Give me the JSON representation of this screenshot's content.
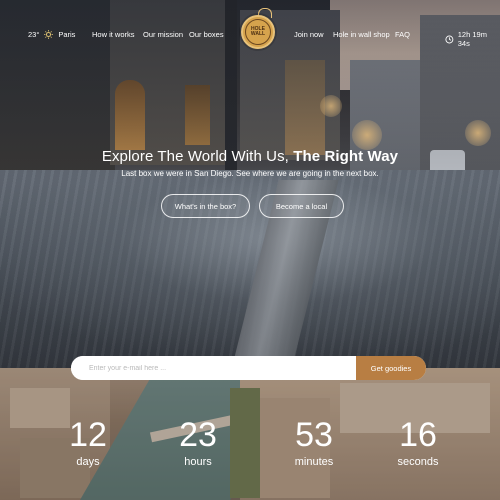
{
  "nav": {
    "temperature": "23°",
    "city": "Paris",
    "links": [
      "How it works",
      "Our mission",
      "Our boxes"
    ],
    "right_links": [
      "Join now",
      "Hole in wall shop",
      "FAQ"
    ],
    "timer": "12h 19m 34s",
    "icons": {
      "weather": "sun-icon",
      "timer": "clock-icon"
    },
    "logo": "HOLE IN THE WALL"
  },
  "hero": {
    "headline": "Explore The World With Us, ",
    "headline_bold": "The Right Way",
    "subline": "Last box we were in San Diego. See where we are going in the next box.",
    "buttons": [
      "What's in the box?",
      "Become a local"
    ]
  },
  "signup": {
    "placeholder": "Enter your e-mail here ...",
    "button": "Get goodies",
    "accent": "#b87e43"
  },
  "countdown": [
    {
      "value": "12",
      "unit": "days"
    },
    {
      "value": "23",
      "unit": "hours"
    },
    {
      "value": "53",
      "unit": "minutes"
    },
    {
      "value": "16",
      "unit": "seconds"
    }
  ]
}
